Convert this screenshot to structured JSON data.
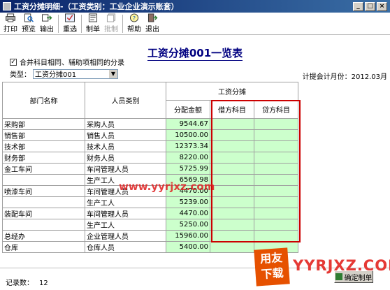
{
  "window": {
    "title": "工资分摊明细-（工资类别：工业企业演示账套）",
    "controls": [
      "_",
      "□",
      "×"
    ]
  },
  "toolbar": {
    "items": [
      {
        "label": "打印",
        "icon": "printer-icon",
        "enabled": true
      },
      {
        "label": "预览",
        "icon": "preview-icon",
        "enabled": true
      },
      {
        "label": "输出",
        "icon": "export-icon",
        "enabled": true
      },
      {
        "label": "重选",
        "icon": "reselect-icon",
        "enabled": true
      },
      {
        "label": "制单",
        "icon": "voucher-icon",
        "enabled": true
      },
      {
        "label": "批制",
        "icon": "batch-voucher-icon",
        "enabled": false
      },
      {
        "label": "帮助",
        "icon": "help-icon",
        "enabled": true
      },
      {
        "label": "退出",
        "icon": "exit-icon",
        "enabled": true
      }
    ]
  },
  "report": {
    "title": "工资分摊001一览表",
    "merge_option": {
      "label": "合并科目相同、辅助项相同的分录",
      "checked": true
    },
    "type_label": "类型：",
    "type_value": "工资分摊001",
    "period": "计提会计月份：2012.03月"
  },
  "table": {
    "headers": {
      "department": "部门名称",
      "category": "人员类别",
      "group": "工资分摊",
      "amount": "分配金额",
      "debit": "借方科目",
      "credit": "贷方科目"
    },
    "rows": [
      {
        "dept": "采购部",
        "category": "采购人员",
        "amount": "9544.67"
      },
      {
        "dept": "销售部",
        "category": "销售人员",
        "amount": "10500.00"
      },
      {
        "dept": "技术部",
        "category": "技术人员",
        "amount": "12373.34"
      },
      {
        "dept": "财务部",
        "category": "财务人员",
        "amount": "8220.00"
      },
      {
        "dept": "金工车间",
        "category": "车间管理人员",
        "amount": "5725.99"
      },
      {
        "dept": "",
        "category": "生产工人",
        "amount": "6569.98"
      },
      {
        "dept": "喷漆车间",
        "category": "车间管理人员",
        "amount": "4470.00"
      },
      {
        "dept": "",
        "category": "生产工人",
        "amount": "5239.00"
      },
      {
        "dept": "装配车间",
        "category": "车间管理人员",
        "amount": "4470.00"
      },
      {
        "dept": "",
        "category": "生产工人",
        "amount": "5250.00"
      },
      {
        "dept": "总经办",
        "category": "企业管理人员",
        "amount": "15960.00"
      },
      {
        "dept": "仓库",
        "category": "仓库人员",
        "amount": "5400.00"
      }
    ]
  },
  "footer": {
    "record_label": "记录数：",
    "record_count": "12",
    "confirm_label": "确定制单"
  },
  "watermark": {
    "logo_text": "用友下载",
    "url_text": "YYRJXZ.COM",
    "overlay_url": "www.yyrjxz.com"
  },
  "colors": {
    "title_bar": "#0a246a",
    "highlight_green": "#ccffcc",
    "frame_red": "#cc0000",
    "report_title": "#000080"
  }
}
